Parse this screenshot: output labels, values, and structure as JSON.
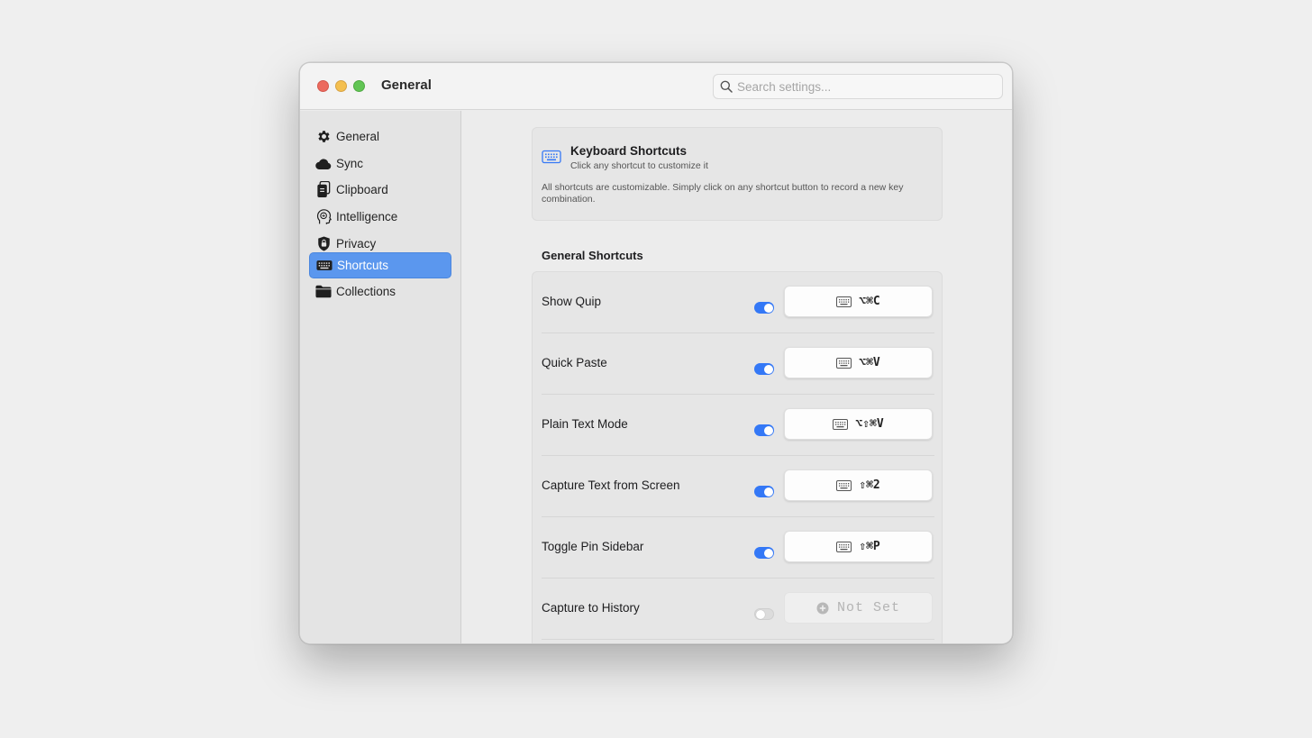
{
  "window": {
    "title": "General"
  },
  "search": {
    "placeholder": "Search settings..."
  },
  "sidebar": {
    "items": [
      {
        "label": "General",
        "icon": "gear-icon",
        "active": false
      },
      {
        "label": "Sync",
        "icon": "cloud-icon",
        "active": false
      },
      {
        "label": "Clipboard",
        "icon": "clipboard-icon",
        "active": false
      },
      {
        "label": "Intelligence",
        "icon": "brain-head-icon",
        "active": false
      },
      {
        "label": "Privacy",
        "icon": "lock-shield-icon",
        "active": false
      },
      {
        "label": "Shortcuts",
        "icon": "keyboard-icon",
        "active": true
      },
      {
        "label": "Collections",
        "icon": "folder-icon",
        "active": false
      }
    ]
  },
  "info": {
    "title": "Keyboard Shortcuts",
    "subtitle": "Click any shortcut to customize it",
    "body": "All shortcuts are customizable. Simply click on any shortcut button to record a new key combination."
  },
  "section": {
    "title": "General Shortcuts"
  },
  "shortcuts": [
    {
      "label": "Show Quip",
      "enabled": true,
      "keys": "⌥⌘C"
    },
    {
      "label": "Quick Paste",
      "enabled": true,
      "keys": "⌥⌘V"
    },
    {
      "label": "Plain Text Mode",
      "enabled": true,
      "keys": "⌥⇧⌘V"
    },
    {
      "label": "Capture Text from Screen",
      "enabled": true,
      "keys": "⇧⌘2"
    },
    {
      "label": "Toggle Pin Sidebar",
      "enabled": true,
      "keys": "⇧⌘P"
    },
    {
      "label": "Capture to History",
      "enabled": false,
      "keys": "Not Set"
    }
  ],
  "colors": {
    "accent": "#3478f6",
    "sidebar_selection": "#5b97ee",
    "traffic_close": "#ec6a5e",
    "traffic_minimize": "#f4bf4f",
    "traffic_maximize": "#61c554"
  }
}
